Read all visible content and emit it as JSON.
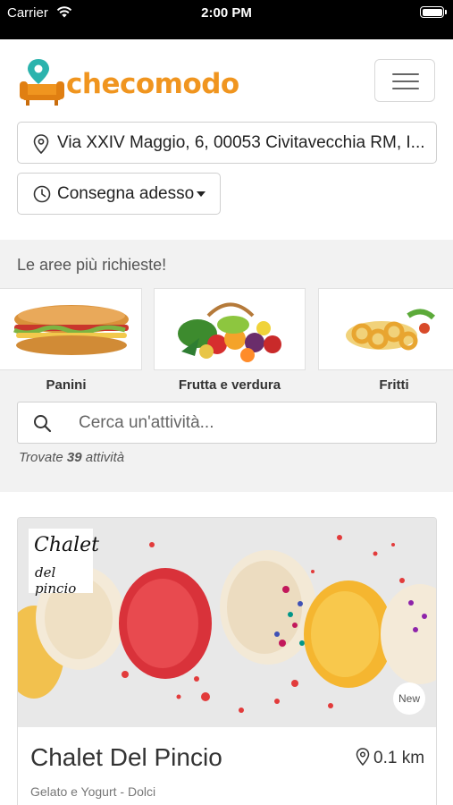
{
  "status_bar": {
    "carrier": "Carrier",
    "time": "2:00 PM"
  },
  "header": {
    "logo_text": "checomodo",
    "address": "Via XXIV Maggio, 6, 00053 Civitavecchia RM, I...",
    "delivery_time": "Consegna adesso"
  },
  "areas": {
    "title": "Le aree più richieste!",
    "categories": [
      {
        "label": "Panini",
        "image": "sandwich-image"
      },
      {
        "label": "Frutta e verdura",
        "image": "fruits-vegetables-image"
      },
      {
        "label": "Fritti",
        "image": "fried-food-image"
      }
    ]
  },
  "search": {
    "placeholder": "Cerca un'attività...",
    "value": ""
  },
  "results": {
    "prefix": "Trovate",
    "count": "39",
    "suffix": "attività"
  },
  "listing": {
    "name": "Chalet Del Pincio",
    "distance": "0.1 km",
    "categories": "Gelato e Yogurt - Dolci",
    "badge": "New",
    "brand_line1": "Chalet",
    "brand_line2": "del pincio"
  },
  "colors": {
    "brand": "#f0951f",
    "brand_pin": "#2bb3ad",
    "section_bg": "#f2f2f2"
  }
}
